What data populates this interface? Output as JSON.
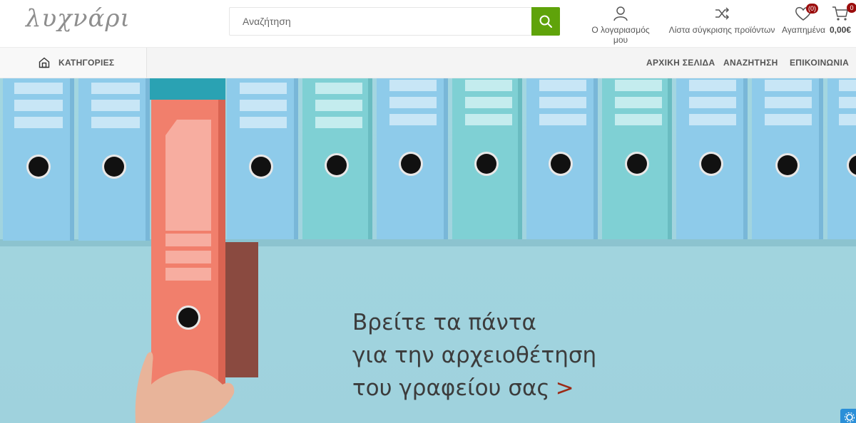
{
  "header": {
    "logo_text": "λυχνάρι",
    "search": {
      "placeholder": "Αναζήτηση",
      "value": ""
    },
    "account_label": "Ο λογαριασμός μου",
    "compare_label": "Λίστα σύγκρισης προϊόντων",
    "wishlist_label": "Αγαπημένα",
    "wishlist_count": "(0)",
    "cart_count": "0",
    "cart_total": "0,00€"
  },
  "nav": {
    "categories_label": "ΚΑΤΗΓΟΡΙΕΣ",
    "items": [
      {
        "label": "ΑΡΧΙΚΗ ΣΕΛΙΔΑ"
      },
      {
        "label": "ΑΝΑΖΗΤΗΣΗ"
      },
      {
        "label": "ΕΠΙΚΟΙΝΩΝΙΑ"
      }
    ]
  },
  "hero": {
    "line1": "Βρείτε τα πάντα",
    "line2": "για την αρχειοθέτηση",
    "line3": "του γραφείου σας",
    "arrow": ">"
  },
  "colors": {
    "accent_green": "#5fa30a",
    "badge_red": "#9b0d0d",
    "binder_blue": "#8ecbea",
    "binder_teal": "#7fd0d4",
    "binder_orange": "#f17f6c"
  }
}
